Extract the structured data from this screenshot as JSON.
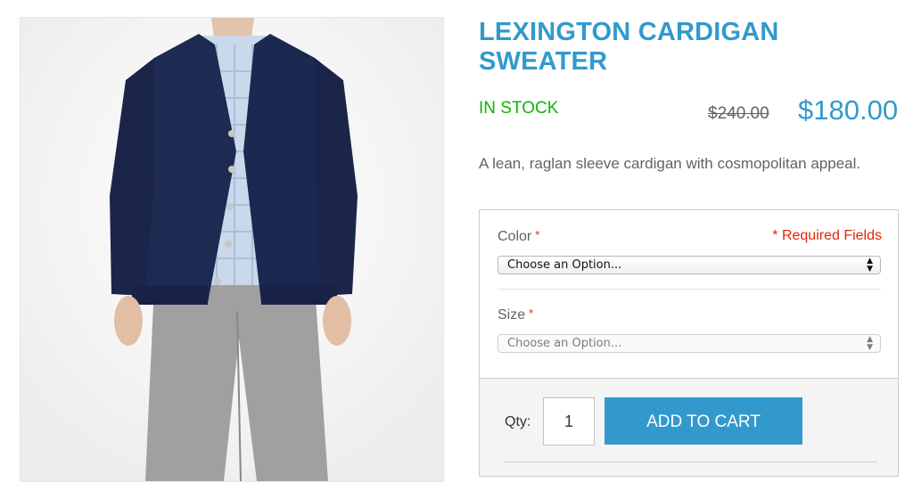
{
  "product": {
    "title": "LEXINGTON CARDIGAN SWEATER",
    "stock_status": "IN STOCK",
    "old_price": "$240.00",
    "price": "$180.00",
    "description": "A lean, raglan sleeve cardigan with cosmopolitan appeal.",
    "image_icon": "product-photo-model-cardigan"
  },
  "options": {
    "required_note": "* Required Fields",
    "color": {
      "label": "Color",
      "required_marker": "*",
      "selected": "Choose an Option..."
    },
    "size": {
      "label": "Size",
      "required_marker": "*",
      "selected": "Choose an Option..."
    }
  },
  "cart": {
    "qty_label": "Qty:",
    "qty_value": "1",
    "add_to_cart_label": "ADD TO CART"
  },
  "colors": {
    "accent": "#3399cc",
    "in_stock": "#11b400",
    "required": "#df280a"
  }
}
